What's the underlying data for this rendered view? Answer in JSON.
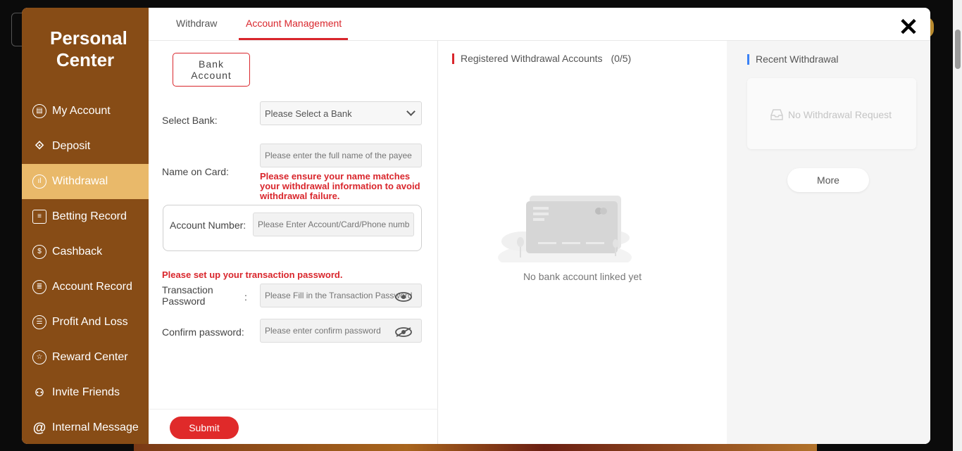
{
  "sidebar": {
    "title": "Personal Center",
    "items": [
      {
        "label": "My Account",
        "icon": "wallet-icon"
      },
      {
        "label": "Deposit",
        "icon": "ticket-icon"
      },
      {
        "label": "Withdrawal",
        "icon": "withdraw-icon"
      },
      {
        "label": "Betting Record",
        "icon": "clipboard-icon"
      },
      {
        "label": "Cashback",
        "icon": "money-bag-icon"
      },
      {
        "label": "Account Record",
        "icon": "ledger-icon"
      },
      {
        "label": "Profit And Loss",
        "icon": "list-icon"
      },
      {
        "label": "Reward Center",
        "icon": "star-icon"
      },
      {
        "label": "Invite Friends",
        "icon": "add-user-icon"
      },
      {
        "label": "Internal Message",
        "icon": "at-icon"
      }
    ],
    "active_index": 2
  },
  "tabs": [
    {
      "label": "Withdraw"
    },
    {
      "label": "Account Management"
    }
  ],
  "active_tab": 1,
  "form": {
    "bank_button": "Bank Account",
    "select_bank_label": "Select Bank",
    "select_bank_value": "Please Select a Bank",
    "name_label": "Name on Card",
    "name_placeholder": "Please enter the full name of the payee",
    "name_warning": "Please ensure your name matches your withdrawal information to avoid withdrawal failure.",
    "account_label": "Account Number",
    "account_placeholder": "Please Enter Account/Card/Phone number",
    "password_warning": "Please set up your transaction password.",
    "password_label": "Transaction Password",
    "password_placeholder": "Please Fill in the Transaction Password",
    "confirm_label": "Confirm password",
    "confirm_placeholder": "Please enter confirm password",
    "colon": ":",
    "submit": "Submit"
  },
  "registered": {
    "title": "Registered Withdrawal Accounts",
    "count": "(0/5)",
    "empty": "No bank account linked yet"
  },
  "recent": {
    "title": "Recent Withdrawal",
    "empty": "No Withdrawal Request",
    "more": "More"
  },
  "colors": {
    "sidebar": "#874c16",
    "active_nav": "#e9b96a",
    "accent_red": "#d9262c",
    "blue_bar": "#3b82f6"
  }
}
